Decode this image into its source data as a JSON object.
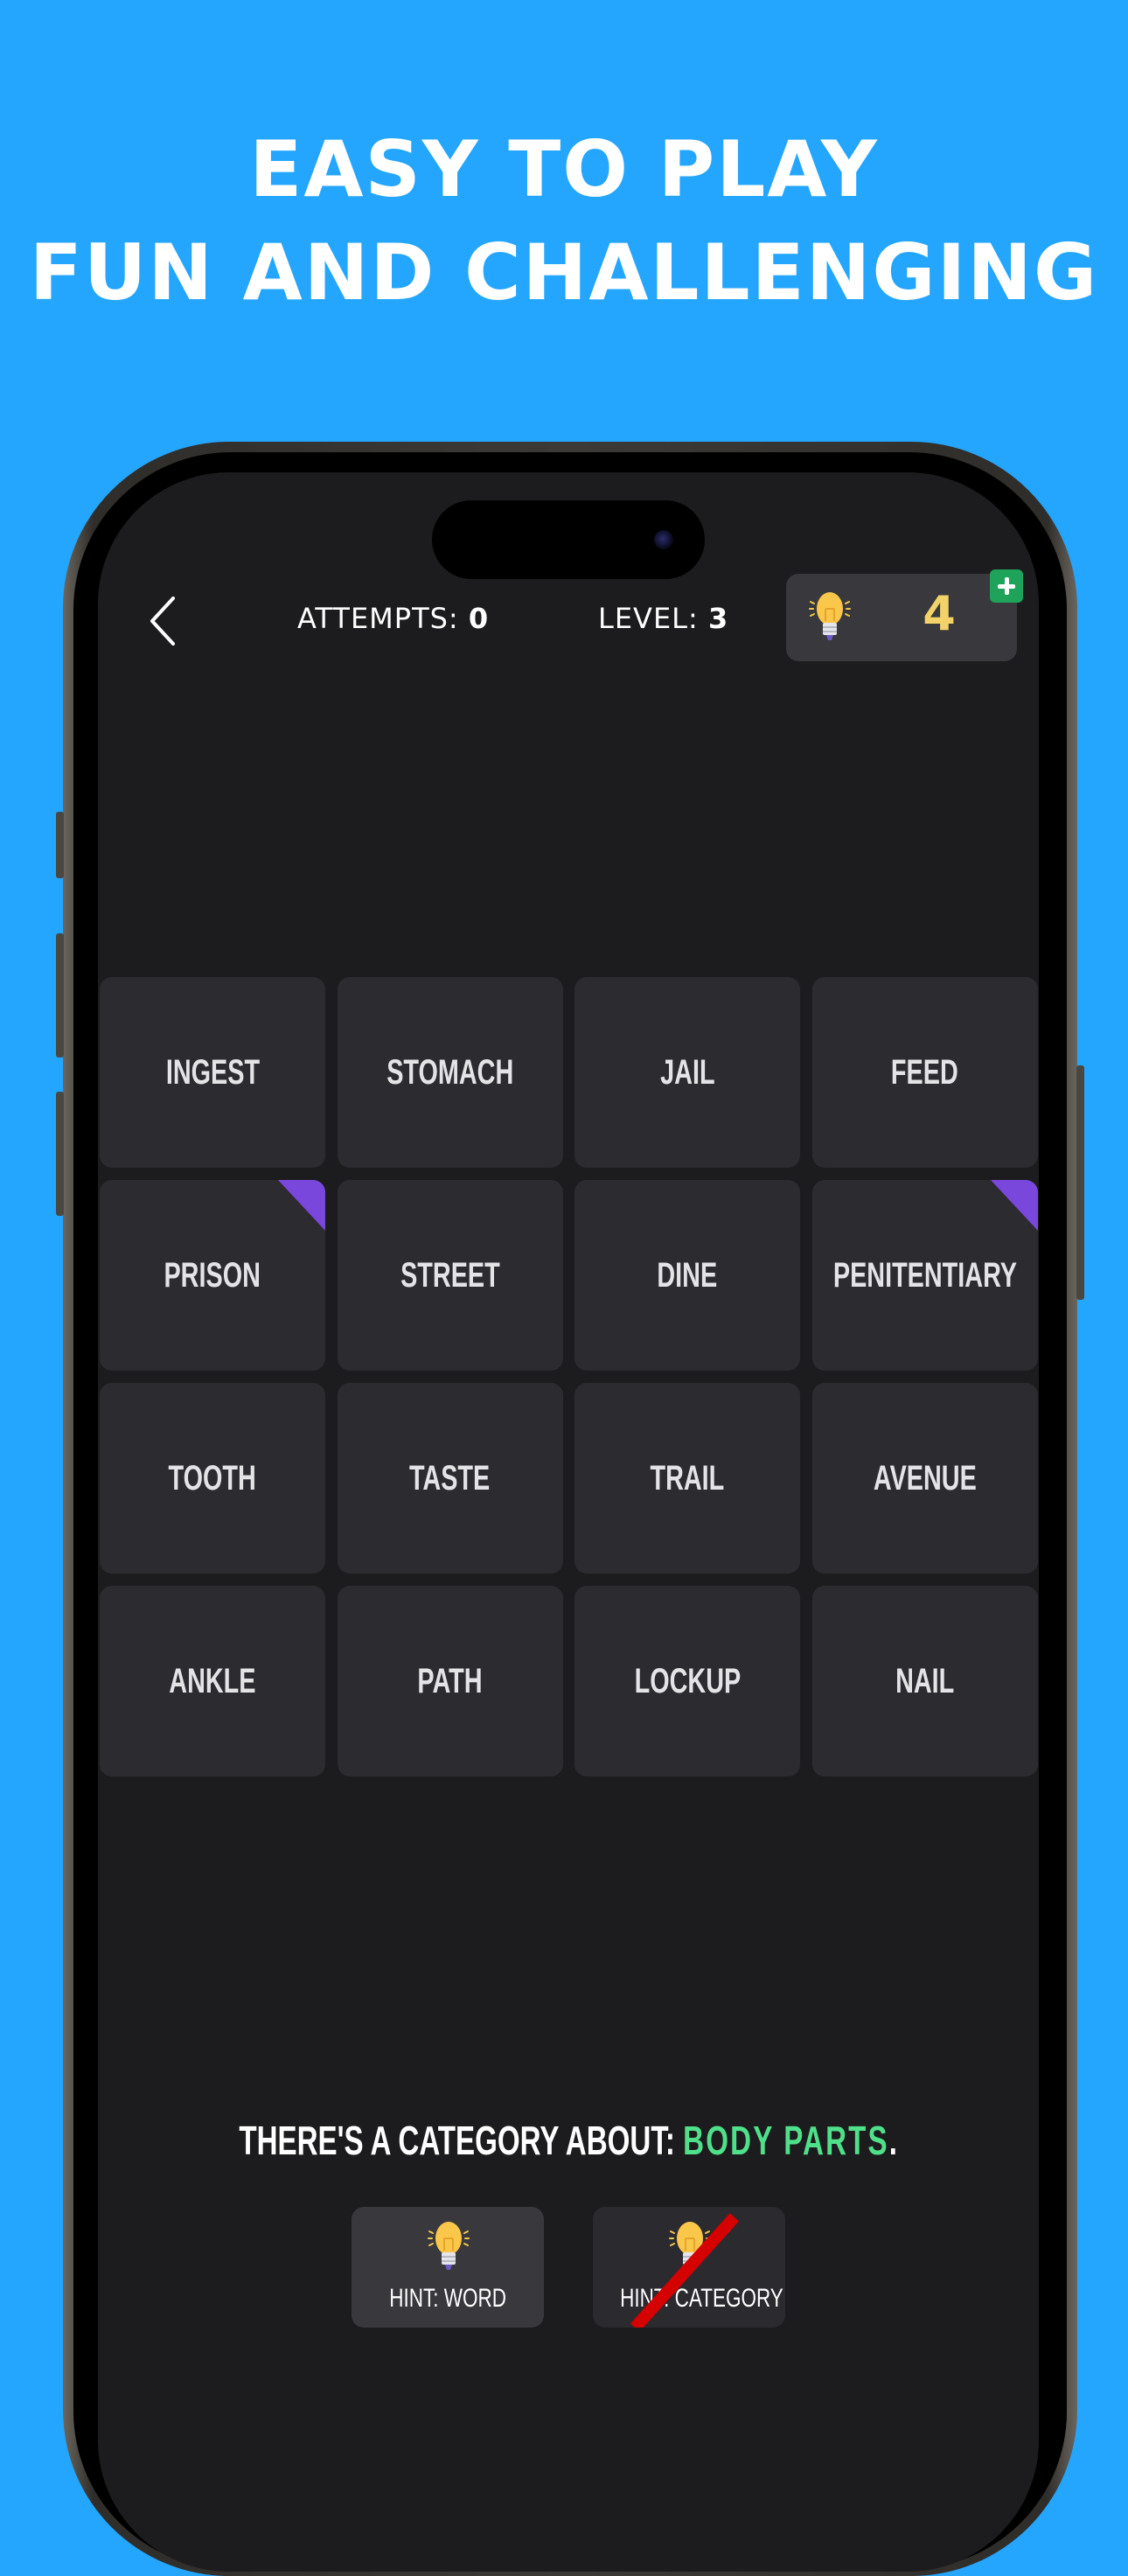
{
  "promo": {
    "headline_line1": "EASY TO PLAY",
    "headline_line2": "FUN AND CHALLENGING",
    "background_color": "#24a6ff"
  },
  "header": {
    "back_icon": "chevron-left-icon",
    "attempts_label": "ATTEMPTS:",
    "attempts_value": "0",
    "level_label": "LEVEL:",
    "level_value": "3",
    "hints_icon": "lightbulb-icon",
    "hints_count": "4",
    "add_hints_icon": "plus-icon",
    "add_hints_color": "#1fa25a",
    "hints_count_color": "#f4d26a"
  },
  "grid": {
    "tiles": [
      {
        "word": "INGEST",
        "flagged": false
      },
      {
        "word": "STOMACH",
        "flagged": false
      },
      {
        "word": "JAIL",
        "flagged": false
      },
      {
        "word": "FEED",
        "flagged": false
      },
      {
        "word": "PRISON",
        "flagged": true
      },
      {
        "word": "STREET",
        "flagged": false
      },
      {
        "word": "DINE",
        "flagged": false
      },
      {
        "word": "PENITENTIARY",
        "flagged": true
      },
      {
        "word": "TOOTH",
        "flagged": false
      },
      {
        "word": "TASTE",
        "flagged": false
      },
      {
        "word": "TRAIL",
        "flagged": false
      },
      {
        "word": "AVENUE",
        "flagged": false
      },
      {
        "word": "ANKLE",
        "flagged": false
      },
      {
        "word": "PATH",
        "flagged": false
      },
      {
        "word": "LOCKUP",
        "flagged": false
      },
      {
        "word": "NAIL",
        "flagged": false
      }
    ],
    "flag_color": "#7a47dd"
  },
  "category_hint": {
    "prefix": "THERE'S A CATEGORY ABOUT:",
    "category": "BODY PARTS",
    "suffix": ".",
    "category_color": "#4fe08a"
  },
  "hint_buttons": [
    {
      "label": "HINT: WORD",
      "icon": "lightbulb-icon",
      "disabled": false
    },
    {
      "label": "HINT: CATEGORY",
      "icon": "lightbulb-icon",
      "disabled": true,
      "overlay": "red-strike"
    }
  ]
}
